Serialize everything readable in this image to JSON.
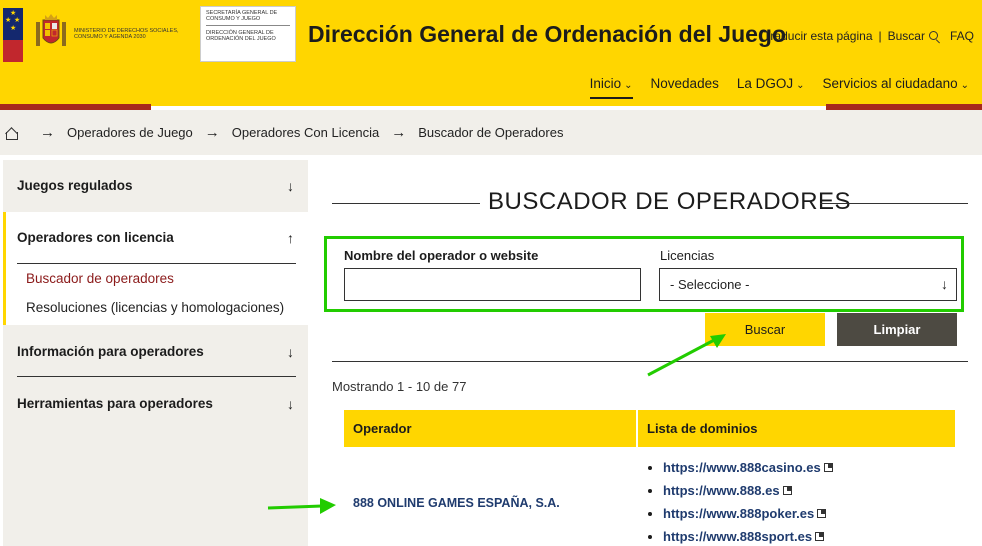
{
  "header": {
    "ministry_text": "Ministerio de Derechos Sociales, Consumo y Agenda 2030",
    "secretaria_text": "Secretaría General de Consumo y Juego",
    "direccion_text": "Dirección General de Ordenación del Juego",
    "site_title": "Dirección General de Ordenación del Juego",
    "translate_label": "Traducir esta página",
    "search_label": "Buscar",
    "faq_label": "FAQ",
    "nav": [
      {
        "label": "Inicio",
        "active": true,
        "has_dropdown": true
      },
      {
        "label": "Novedades",
        "active": false,
        "has_dropdown": false
      },
      {
        "label": "La DGOJ",
        "active": false,
        "has_dropdown": true
      },
      {
        "label": "Servicios al ciudadano",
        "active": false,
        "has_dropdown": true
      }
    ]
  },
  "breadcrumb": {
    "items": [
      "Operadores de Juego",
      "Operadores Con Licencia",
      "Buscador de Operadores"
    ]
  },
  "sidebar": {
    "items": [
      {
        "label": "Juegos regulados",
        "arrow": "↓"
      },
      {
        "label": "Operadores con licencia",
        "arrow": "↑"
      },
      {
        "label": "Información para operadores",
        "arrow": "↓"
      },
      {
        "label": "Herramientas para operadores",
        "arrow": "↓"
      }
    ],
    "subitems": [
      {
        "label": "Buscador de operadores",
        "active": true
      },
      {
        "label": "Resoluciones (licencias y homologaciones)",
        "active": false
      }
    ]
  },
  "main": {
    "title": "BUSCADOR DE OPERADORES",
    "form": {
      "name_label": "Nombre del operador o website",
      "name_value": "",
      "license_label": "Licencias",
      "license_selected": "- Seleccione -"
    },
    "buttons": {
      "search": "Buscar",
      "clear": "Limpiar"
    },
    "showing": "Mostrando 1 - 10 de 77",
    "table": {
      "headers": [
        "Operador",
        "Lista de dominios"
      ],
      "rows": [
        {
          "operator": "888 ONLINE GAMES ESPAÑA, S.A.",
          "domains": [
            "https://www.888casino.es",
            "https://www.888.es",
            "https://www.888poker.es",
            "https://www.888sport.es"
          ]
        }
      ]
    }
  },
  "colors": {
    "brand_yellow": "#ffd600",
    "brand_red": "#a62a1d",
    "annotation_green": "#22cc00",
    "link_blue": "#1f3b6e"
  }
}
